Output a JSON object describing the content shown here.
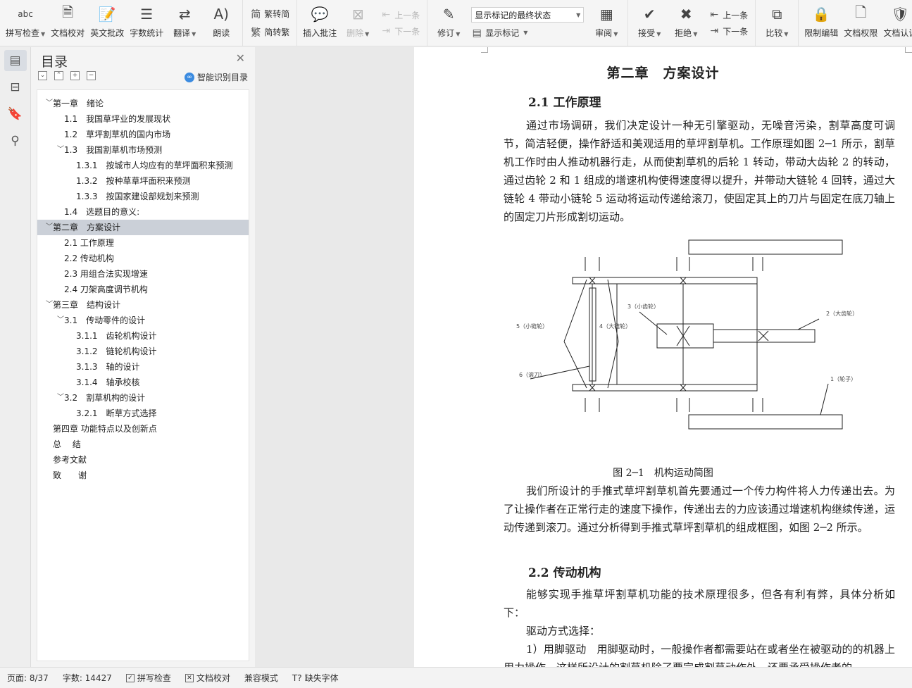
{
  "ribbon": {
    "spell_check": "拼写检查",
    "doc_proofread": "文档校对",
    "en_review": "英文批改",
    "word_count": "字数统计",
    "translate": "翻译",
    "read_aloud": "朗读",
    "trad_conv": "繁转简",
    "simp_conv": "简转繁",
    "insert_comment": "插入批注",
    "delete": "删除",
    "prev": "上一条",
    "next": "下一条",
    "track": "修订",
    "markup_state": "显示标记的最终状态",
    "show_markup": "显示标记",
    "review": "审阅",
    "accept": "接受",
    "reject": "拒绝",
    "prev2": "上一条",
    "next2": "下一条",
    "compare": "比较",
    "restrict_edit": "限制编辑",
    "doc_perm": "文档权限",
    "doc_cert": "文档认证",
    "doc_more": "文"
  },
  "toc": {
    "title": "目录",
    "smart_label": "智能识别目录",
    "items": [
      {
        "text": "第一章　绪论",
        "level": 0,
        "chev": "open"
      },
      {
        "text": "1.1　我国草坪业的发展现状",
        "level": 1
      },
      {
        "text": "1.2　草坪割草机的国内市场",
        "level": 1
      },
      {
        "text": "1.3　我国割草机市场预测",
        "level": 1,
        "chev": "open"
      },
      {
        "text": "1.3.1　按城市人均应有的草坪面积来预测",
        "level": 2
      },
      {
        "text": "1.3.2　按种草草坪面积来预测",
        "level": 2
      },
      {
        "text": "1.3.3　按国家建设部规划来预测",
        "level": 2
      },
      {
        "text": "1.4　选题目的意义:",
        "level": 1
      },
      {
        "text": "第二章　方案设计",
        "level": 0,
        "chev": "open",
        "selected": true
      },
      {
        "text": "2.1 工作原理",
        "level": 1
      },
      {
        "text": "2.2 传动机构",
        "level": 1
      },
      {
        "text": "2.3 用组合法实现增速",
        "level": 1
      },
      {
        "text": "2.4 刀架高度调节机构",
        "level": 1
      },
      {
        "text": "第三章　结构设计",
        "level": 0,
        "chev": "open"
      },
      {
        "text": "3.1　传动零件的设计",
        "level": 1,
        "chev": "open"
      },
      {
        "text": "3.1.1　齿轮机构设计",
        "level": 2
      },
      {
        "text": "3.1.2　链轮机构设计",
        "level": 2
      },
      {
        "text": "3.1.3　轴的设计",
        "level": 2
      },
      {
        "text": "3.1.4　轴承校核",
        "level": 2
      },
      {
        "text": "3.2　割草机构的设计",
        "level": 1,
        "chev": "open"
      },
      {
        "text": "3.2.1　断草方式选择",
        "level": 2
      },
      {
        "text": "第四章 功能特点以及创新点",
        "level": 0
      },
      {
        "text": "总　 结",
        "level": 0
      },
      {
        "text": "参考文献",
        "level": 0
      },
      {
        "text": "致　　谢",
        "level": 0
      }
    ]
  },
  "document": {
    "chapter": "第二章　方案设计",
    "h_2_1": "2.1  工作原理",
    "p1": "通过市场调研，我们决定设计一种无引擎驱动，无噪音污染，割草高度可调节，简洁轻便，操作舒适和美观适用的草坪割草机。工作原理如图 2─1 所示，割草机工作时由人推动机器行走，从而使割草机的后轮 1 转动，带动大齿轮 2 的转动，通过齿轮 2 和 1 组成的增速机构使得速度得以提升，并带动大链轮 4 回转，通过大链轮 4 带动小链轮 5 运动将运动传递给滚刀，使固定其上的刀片与固定在底刀轴上的固定刀片形成割切运动。",
    "fig_labels": {
      "small_gear": "3（小齿轮）",
      "big_gear": "2（大齿轮）",
      "small_sprocket": "5（小链轮）",
      "big_sprocket": "4（大链轮）",
      "roller": "6（滚刀）",
      "wheel": "1（轮子）"
    },
    "caption": "图 2─1　机构运动简图",
    "p2": "我们所设计的手推式草坪割草机首先要通过一个传力构件将人力传递出去。为了让操作者在正常行走的速度下操作，传递出去的力应该通过增速机构继续传递，运动传递到滚刀。通过分析得到手推式草坪割草机的组成框图，如图 2─2 所示。",
    "h_2_2": "2.2  传动机构",
    "p3": "能够实现手推草坪割草机功能的技术原理很多，但各有利有弊，具体分析如下：",
    "p4": "驱动方式选择：",
    "p5": "1）用脚驱动　用脚驱动时，一般操作者都需要站在或者坐在被驱动的的机器上用力操作，这样所设计的割草机除了要完成割草动作外，还要承受操作者的"
  },
  "status": {
    "page": "页面: 8/37",
    "words": "字数: 14427",
    "spell": "拼写检查",
    "proof": "文档校对",
    "compat": "兼容模式",
    "missing_font": "缺失字体"
  }
}
